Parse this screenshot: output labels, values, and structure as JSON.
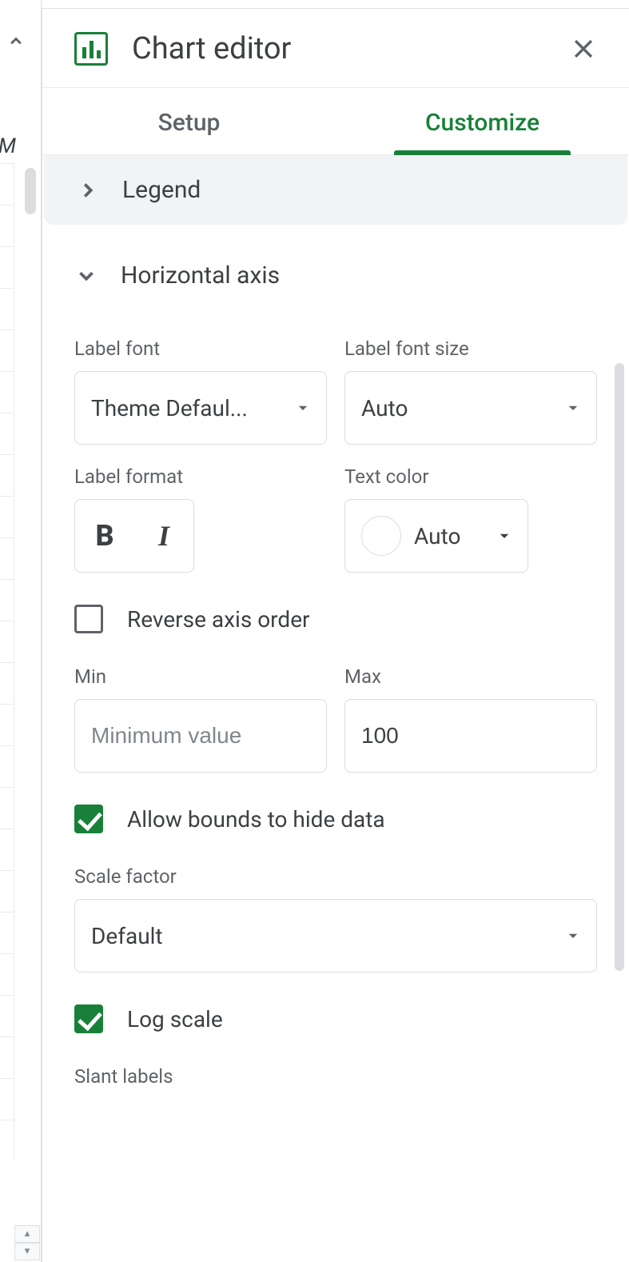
{
  "header": {
    "title": "Chart editor"
  },
  "tabs": {
    "setup": "Setup",
    "customize": "Customize"
  },
  "sections": {
    "legend": {
      "title": "Legend"
    },
    "haxis": {
      "title": "Horizontal axis",
      "label_font": {
        "label": "Label font",
        "value": "Theme Defaul..."
      },
      "label_font_size": {
        "label": "Label font size",
        "value": "Auto"
      },
      "label_format": {
        "label": "Label format"
      },
      "text_color": {
        "label": "Text color",
        "value": "Auto"
      },
      "reverse": {
        "label": "Reverse axis order"
      },
      "min": {
        "label": "Min",
        "placeholder": "Minimum value",
        "value": ""
      },
      "max": {
        "label": "Max",
        "value": "100"
      },
      "allow_bounds": {
        "label": "Allow bounds to hide data"
      },
      "scale_factor": {
        "label": "Scale factor",
        "value": "Default"
      },
      "log_scale": {
        "label": "Log scale"
      },
      "slant": {
        "label": "Slant labels"
      }
    }
  },
  "left": {
    "col_letter": "M"
  }
}
